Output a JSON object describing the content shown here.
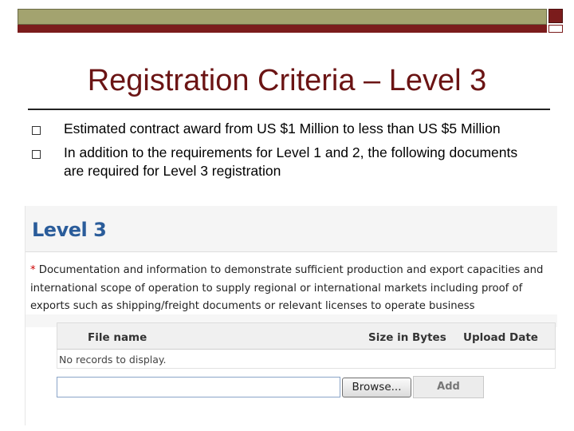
{
  "slide": {
    "title": "Registration Criteria – Level 3",
    "bullets": [
      "Estimated contract award from US $1 Million to less than US $5 Million",
      "In addition to the requirements for Level 1 and 2, the following documents are required for Level 3 registration"
    ]
  },
  "panel": {
    "heading": "Level 3",
    "required_marker": "*",
    "description": "Documentation and information to demonstrate sufficient production and export capacities and international scope of operation to supply regional or international markets including proof of exports such as shipping/freight documents or relevant licenses to operate business",
    "table": {
      "columns": [
        "File name",
        "Size in Bytes",
        "Upload Date"
      ],
      "empty_message": "No records to display."
    },
    "upload": {
      "file_value": "",
      "browse_label": "Browse...",
      "add_label": "Add"
    }
  },
  "colors": {
    "title": "#6b1414",
    "band_olive": "#a3a36f",
    "band_red": "#7b1c1c",
    "heading_blue": "#2a5c9a",
    "required_red": "#cc0000"
  }
}
